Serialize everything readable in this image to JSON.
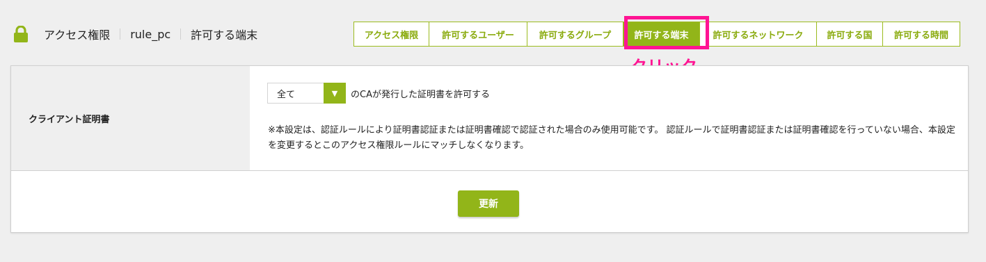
{
  "header": {
    "lock_icon": "lock-icon",
    "breadcrumb": [
      "アクセス権限",
      "rule_pc",
      "許可する端末"
    ],
    "tabs": [
      {
        "label": "アクセス権限",
        "active": false
      },
      {
        "label": "許可するユーザー",
        "active": false
      },
      {
        "label": "許可するグループ",
        "active": false
      },
      {
        "label": "許可する端末",
        "active": true
      },
      {
        "label": "許可するネットワーク",
        "active": false
      },
      {
        "label": "許可する国",
        "active": false
      },
      {
        "label": "許可する時間",
        "active": false
      }
    ]
  },
  "annotation": {
    "text": "クリック",
    "color": "#ff1493"
  },
  "form": {
    "row_label": "クライアント証明書",
    "select_value": "全て",
    "select_suffix": "のCAが発行した証明書を許可する",
    "note": "※本設定は、認証ルールにより証明書認証または証明書確認で認証された場合のみ使用可能です。 認証ルールで証明書認証または証明書確認を行っていない場合、本設定を変更するとこのアクセス権限ルールにマッチしなくなります。",
    "submit_label": "更新"
  },
  "colors": {
    "accent": "#92b519",
    "background": "#efefef"
  }
}
